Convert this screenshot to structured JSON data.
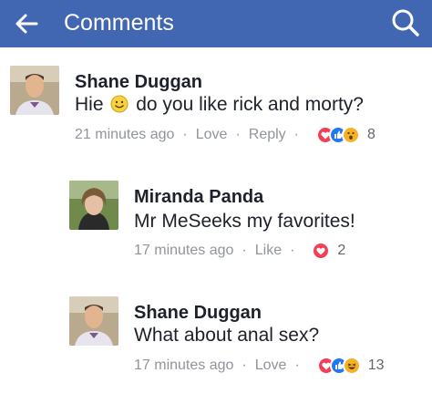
{
  "header": {
    "title": "Comments",
    "back_icon": "arrow-left-icon",
    "search_icon": "search-icon",
    "color": "#4267b2"
  },
  "comments": [
    {
      "author": "Shane Duggan",
      "text_before": "Hie",
      "text_emoji": "smiley-emoji",
      "text_after": "do you like rick and morty?",
      "time": "21 minutes ago",
      "actions": [
        "Love",
        "Reply"
      ],
      "reactions": [
        "love",
        "like",
        "wow"
      ],
      "reaction_count": "8"
    },
    {
      "author": "Miranda Panda",
      "text": "Mr MeSeeks my favorites!",
      "time": "17 minutes ago",
      "actions": [
        "Like"
      ],
      "reactions": [
        "love"
      ],
      "reaction_count": "2"
    },
    {
      "author": "Shane Duggan",
      "text": "What about anal sex?",
      "time": "17 minutes ago",
      "actions": [
        "Love"
      ],
      "reactions": [
        "love",
        "like",
        "haha"
      ],
      "reaction_count": "13"
    }
  ],
  "colors": {
    "love": "#f33e58",
    "like": "#2078f4",
    "reaction_yellow": "#f7b125",
    "meta_text": "#90949c"
  }
}
